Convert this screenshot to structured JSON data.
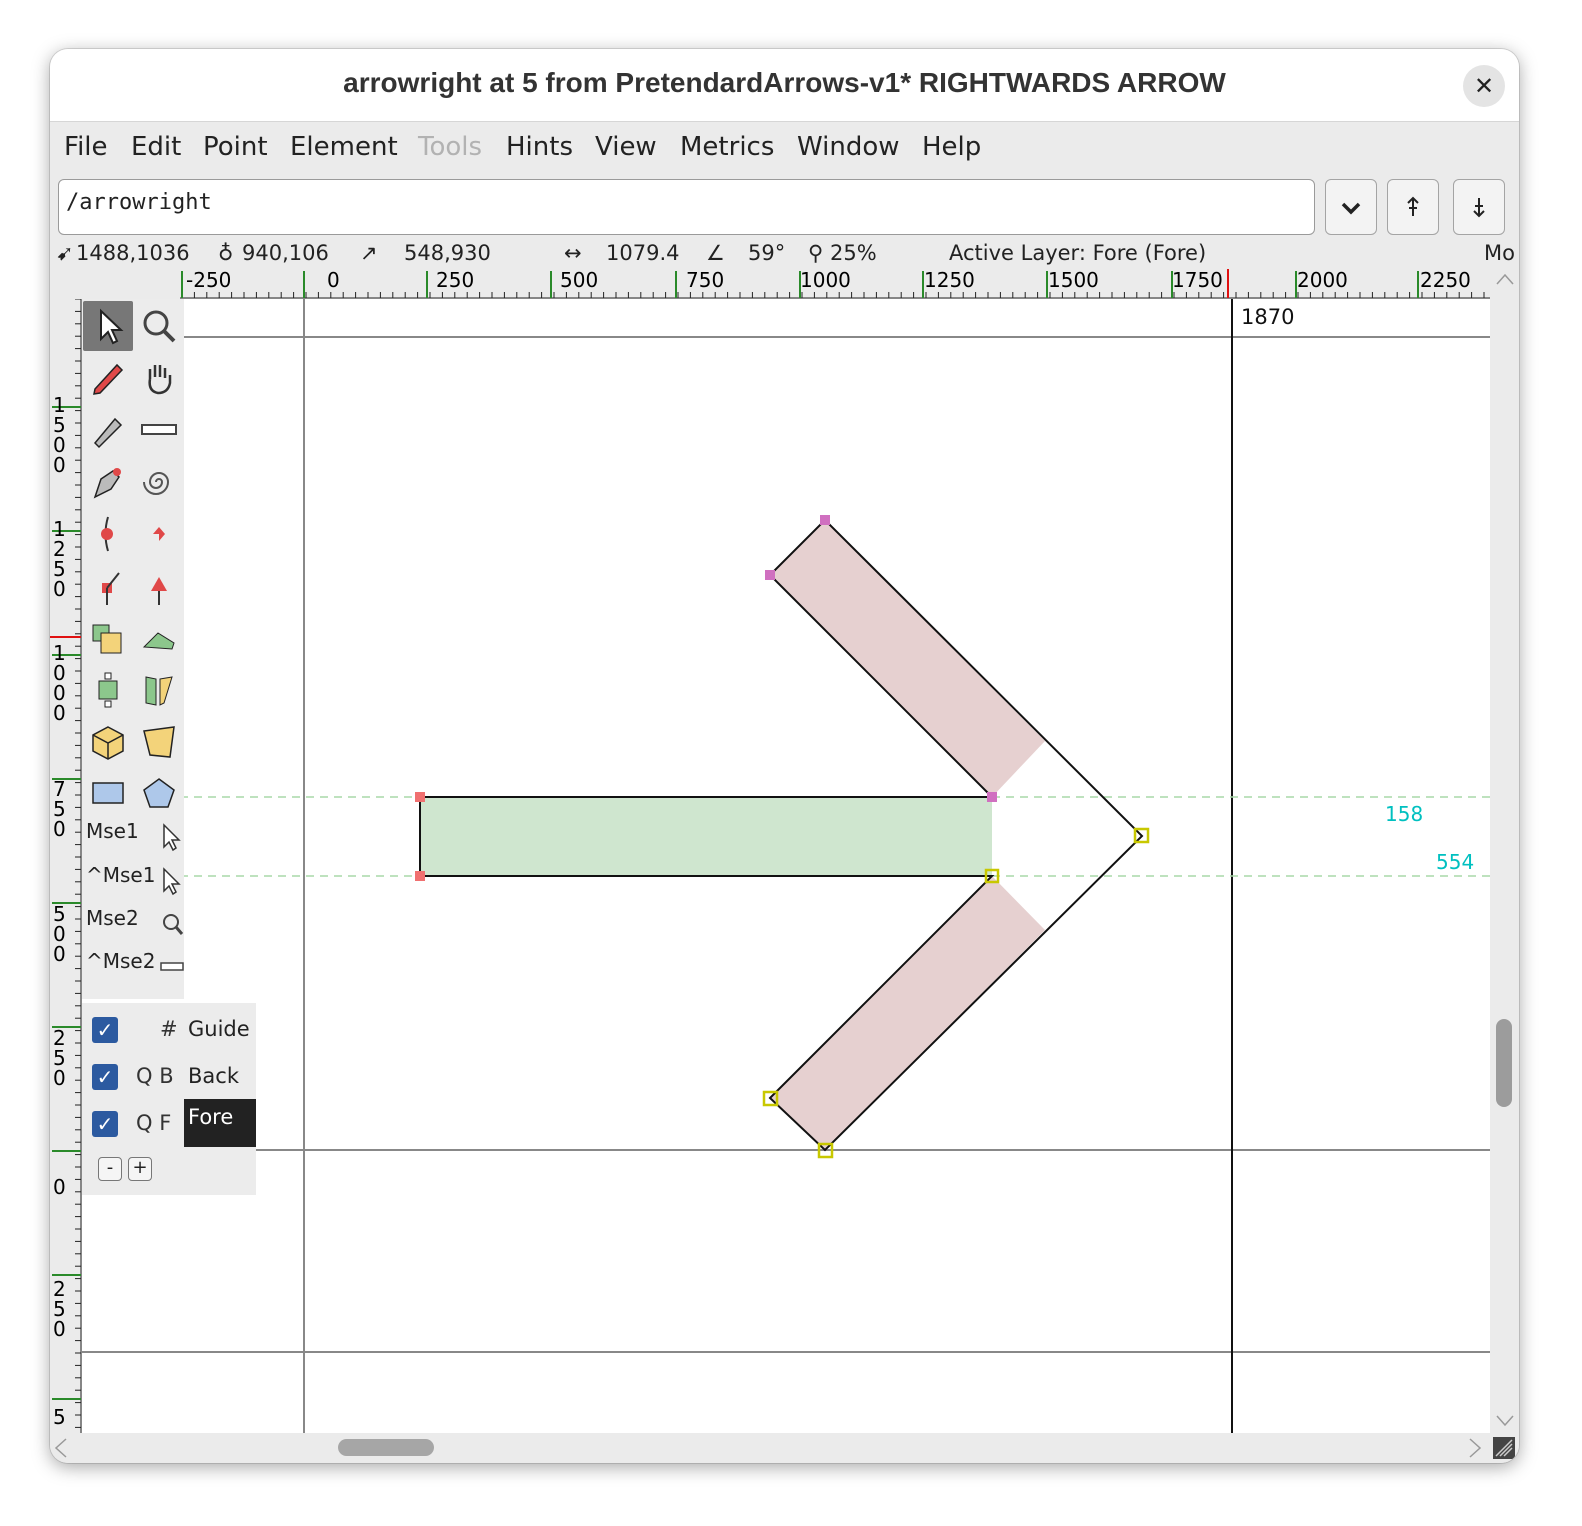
{
  "window": {
    "title": "arrowright at 5 from PretendardArrows-v1* RIGHTWARDS ARROW",
    "close_icon": "close-icon"
  },
  "menu": {
    "items": [
      {
        "label": "File",
        "enabled": true
      },
      {
        "label": "Edit",
        "enabled": true
      },
      {
        "label": "Point",
        "enabled": true
      },
      {
        "label": "Element",
        "enabled": true
      },
      {
        "label": "Tools",
        "enabled": false
      },
      {
        "label": "Hints",
        "enabled": true
      },
      {
        "label": "View",
        "enabled": true
      },
      {
        "label": "Metrics",
        "enabled": true
      },
      {
        "label": "Window",
        "enabled": true
      },
      {
        "label": "Help",
        "enabled": true
      }
    ]
  },
  "glyph_field": {
    "value": "/arrowright"
  },
  "toolbar_buttons": [
    "chevron-down-icon",
    "prev-glyph-icon",
    "next-glyph-icon"
  ],
  "info": {
    "cursor": "1488,1036",
    "point": "940,106",
    "offset": "548,930",
    "distance": "1079.4",
    "angle": "59°",
    "zoom": "25%",
    "active_layer": "Active Layer: Fore (Fore)",
    "mode": "Mo"
  },
  "hruler": {
    "labels": [
      "-250",
      "0",
      "250",
      "500",
      "750",
      "1000",
      "1250",
      "1500",
      "1750",
      "2000",
      "2250"
    ]
  },
  "vruler": {
    "labels": [
      "1500",
      "1250",
      "1000",
      "750",
      "500",
      "250",
      "0",
      "250",
      "5"
    ]
  },
  "canvas": {
    "advance_width_label": "1870",
    "guide_label_1": "158",
    "guide_label_2": "554",
    "colors": {
      "guide": "#00c8c8",
      "fill_main": "#cfe6cf",
      "fill_alt": "#e6d0d0",
      "point_pink": "#d070c0",
      "point_red": "#f07070",
      "point_yellow": "#c8c800"
    }
  },
  "tools": {
    "mse1": "Mse1",
    "cmse1": "^Mse1",
    "mse2": "Mse2",
    "cmse2": "^Mse2",
    "icons": [
      "pointer-icon",
      "magnify-icon",
      "pencil-icon",
      "hand-icon",
      "calligraphy-pen-icon",
      "ruler-icon",
      "pen-icon",
      "spiral-icon",
      "curve-point-icon",
      "hv-curve-point-icon",
      "corner-point-icon",
      "tangent-point-icon",
      "scale-icon",
      "skew-icon",
      "rotate-icon",
      "flip-icon",
      "3d-rotate-icon",
      "perspective-icon",
      "rectangle-icon",
      "polygon-icon"
    ]
  },
  "layers": {
    "rows": [
      {
        "flags": "#",
        "name": "Guide",
        "checked": true,
        "active": false
      },
      {
        "flags": "Q B",
        "name": "Back",
        "checked": true,
        "active": false
      },
      {
        "flags": "Q F",
        "name": "Fore",
        "checked": true,
        "active": true
      }
    ],
    "remove_label": "-",
    "add_label": "+"
  }
}
